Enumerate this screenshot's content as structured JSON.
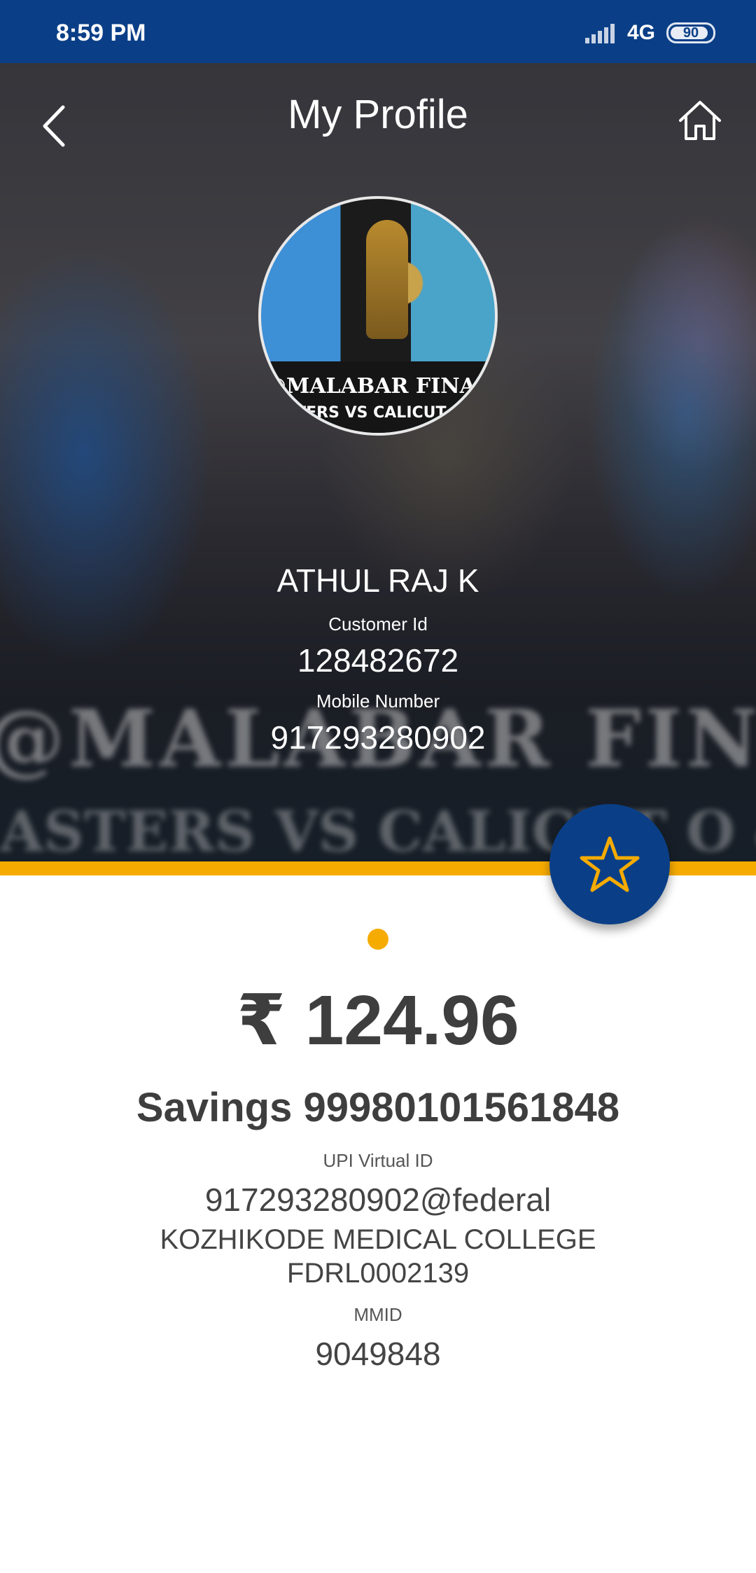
{
  "status_bar": {
    "time": "8:59 PM",
    "network": "4G",
    "battery": "90",
    "icons": [
      "signal-icon",
      "battery-icon"
    ]
  },
  "header": {
    "title": "My Profile",
    "back_icon": "chevron-left-icon",
    "home_icon": "home-icon"
  },
  "profile": {
    "avatar_text_line1": "@MALABAR FINAL",
    "avatar_text_line2": "ASTERS VS CALICUT O &",
    "name": "ATHUL RAJ K",
    "customer_id_label": "Customer Id",
    "customer_id": "128482672",
    "mobile_label": "Mobile Number",
    "mobile": "917293280902",
    "background_text_line1": "@MALABAR FINAL",
    "background_text_line2": "ASTERS VS CALICUT O & M"
  },
  "fab": {
    "icon": "star-icon"
  },
  "account": {
    "balance": "₹ 124.96",
    "account_line": "Savings 99980101561848",
    "upi_label": "UPI Virtual ID",
    "upi_id": "917293280902@federal",
    "branch": "KOZHIKODE MEDICAL COLLEGE",
    "ifsc": "FDRL0002139",
    "mmid_label": "MMID",
    "mmid": "9049848"
  },
  "colors": {
    "primary": "#0a3f87",
    "accent": "#f6ab00",
    "text": "#3e3e3e"
  }
}
